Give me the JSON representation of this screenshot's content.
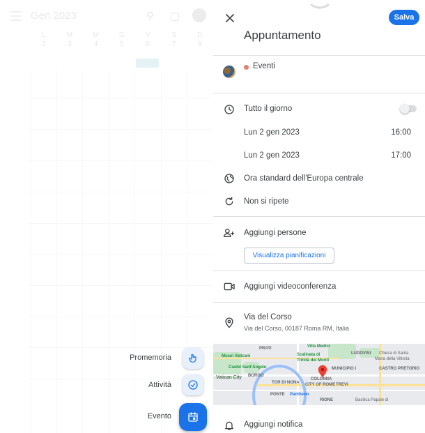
{
  "background_calendar": {
    "month": "Gen 2023",
    "weekdays": [
      "L",
      "M",
      "M",
      "G",
      "V",
      "S",
      "D"
    ],
    "dates": [
      "2",
      "3",
      "4",
      "5",
      "6",
      "7",
      "8"
    ],
    "hours": [
      "",
      "",
      "",
      "",
      "",
      "",
      "",
      "",
      "",
      "",
      ""
    ],
    "event_chip": ""
  },
  "speed_dial": {
    "reminder_label": "Promemoria",
    "task_label": "Attività",
    "event_label": "Evento"
  },
  "editor": {
    "close_icon": "close-icon",
    "save_label": "Salva",
    "title": "Appuntamento",
    "calendar_name": "Eventi",
    "calendar_color": "#e67c73",
    "all_day_label": "Tutto il giorno",
    "all_day_on": false,
    "start_date": "Lun 2 gen 2023",
    "start_time": "16:00",
    "end_date": "Lun 2 gen 2023",
    "end_time": "17:00",
    "timezone": "Ora standard dell'Europa centrale",
    "repeat": "Non si ripete",
    "add_people": "Aggiungi persone",
    "view_schedules": "Visualizza pianificazioni",
    "add_videoconference": "Aggiungi videoconferenza",
    "location_title": "Via del Corso",
    "location_address": "Via del Corso, 00187 Roma RM, Italia",
    "add_notification": "Aggiungi notifica"
  },
  "map": {
    "labels": {
      "prati": "PRATI",
      "villa_medici": "Villa Medici",
      "musei_vaticani": "Musei Vaticani",
      "scalinata": "Scalinata di",
      "trinita": "Trinità dei Monti",
      "ludovisi": "LUDOVISI",
      "chiesa1": "Chiesa di Santa",
      "chiesa2": "Maria della Vittoria",
      "castel": "Castel Sant'Angelo",
      "municipio": "MUNICIPIO I",
      "castro": "CASTRO PRETORIO",
      "vatican": "Vatican City",
      "borgo": "BORGO",
      "tor_di_nona": "TOR DI NONA",
      "colonna": "COLONNA",
      "city_of_rome": "CITY OF ROME",
      "trevi": "TREVI",
      "ponte": "PONTE",
      "pantheon": "Pantheon",
      "rione": "RIONE",
      "basilica": "Basilica Papale di"
    },
    "colors": {
      "park": "#c8e6c9",
      "water": "#9cc0f9",
      "pin": "#ea4335"
    }
  },
  "colors": {
    "accent": "#1a73e8",
    "divider": "#e0e0e0"
  }
}
